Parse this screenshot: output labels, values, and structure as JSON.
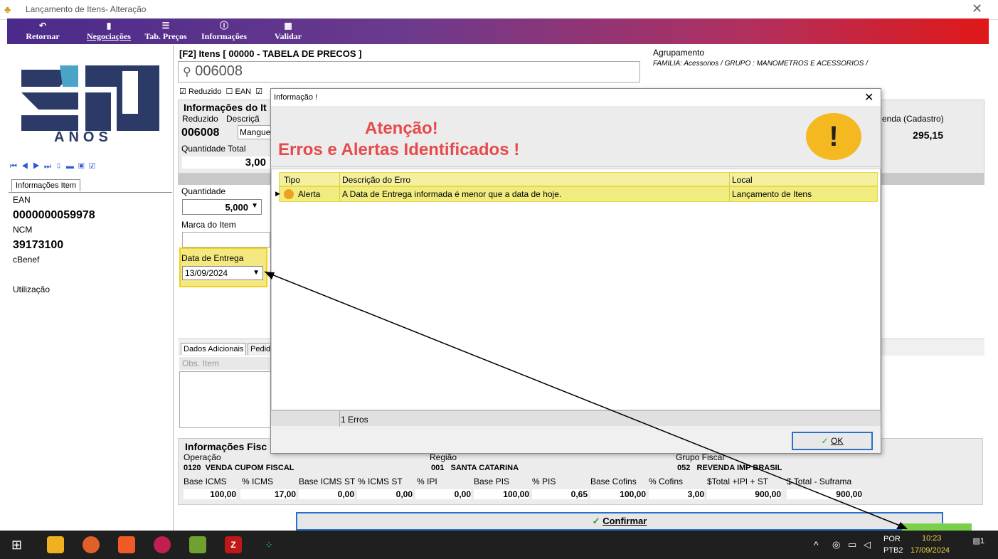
{
  "window": {
    "title": "Lançamento de Itens- Alteração",
    "close": "✕"
  },
  "toolbar": {
    "items": [
      {
        "label": "Retornar",
        "icon": "back-icon"
      },
      {
        "label": "Negociações",
        "icon": "document-icon"
      },
      {
        "label": "Tab. Preços",
        "icon": "list-icon"
      },
      {
        "label": "Informações",
        "icon": "info-icon"
      },
      {
        "label": "Validar",
        "icon": "validate-icon"
      }
    ]
  },
  "left": {
    "logo_text": "ANOS",
    "tab": "Informações Item",
    "ean_label": "EAN",
    "ean": "0000000059978",
    "ncm_label": "NCM",
    "ncm": "39173100",
    "cbenef_label": "cBenef",
    "utilizacao_label": "Utilização"
  },
  "items": {
    "header": "[F2] Itens [ 00000 - TABELA DE PRECOS ]",
    "search_value": "006008",
    "agrupamento_label": "Agrupamento",
    "agrupamento_value": "FAMILIA: Acessorios / GRUPO : MANOMETROS E ACESSORIOS /",
    "chk_reduzido": "Reduzido",
    "chk_ean": "EAN"
  },
  "info_item": {
    "title": "Informações do It",
    "reduzido_label": "Reduzido",
    "descricao_label": "Descriçã",
    "reduzido": "006008",
    "descricao": "Mangue",
    "qtd_total_label": "Quantidade Total",
    "qtd_total": "3,00",
    "venda_label": "enda (Cadastro)",
    "venda": "295,15"
  },
  "entry": {
    "quantidade_label": "Quantidade",
    "quantidade": "5,000",
    "marca_label": "Marca do Item",
    "data_entrega_label": "Data de Entrega",
    "data_entrega": "13/09/2024"
  },
  "tabs2": {
    "dados": "Dados Adicionais",
    "pedido": "Pedid",
    "obs": "Obs. Item"
  },
  "fiscal": {
    "title": "Informações Fisc",
    "operacao_label": "Operação",
    "operacao_code": "0120",
    "operacao": "VENDA CUPOM FISCAL",
    "regiao_label": "Região",
    "regiao_code": "001",
    "regiao": "SANTA CATARINA",
    "grupo_label": "Grupo Fiscal",
    "grupo_code": "052",
    "grupo": "REVENDA IMP BRASIL",
    "cols": [
      "Base ICMS",
      "% ICMS",
      "Base ICMS ST",
      "% ICMS ST",
      "% IPI",
      "Base PIS",
      "% PIS",
      "Base Cofins",
      "% Cofins",
      "$Total +IPI + ST",
      "$ Total - Suframa"
    ],
    "vals": [
      "100,00",
      "17,00",
      "0,00",
      "0,00",
      "0,00",
      "100,00",
      "0,65",
      "100,00",
      "3,00",
      "900,00",
      "900,00"
    ]
  },
  "confirm": "Confirmar",
  "dialog": {
    "title": "Informação !",
    "close": "✕",
    "line1": "Atenção!",
    "line2": "Erros e Alertas Identificados !",
    "icon": "!",
    "col_tipo": "Tipo",
    "col_desc": "Descrição do Erro",
    "col_local": "Local",
    "row_tipo": "Alerta",
    "row_desc": "A Data de Entrega informada é menor que a data de hoje.",
    "row_local": "Lançamento de Itens",
    "status": "1 Erros",
    "ok": "OK"
  },
  "taskbar": {
    "lang1": "POR",
    "lang2": "PTB2",
    "time": "10:23",
    "date": "17/09/2024",
    "notif": "1"
  },
  "colors": {
    "warning": "#e74a4a",
    "highlight": "#f0ec80",
    "accent": "#2a6fc9"
  }
}
